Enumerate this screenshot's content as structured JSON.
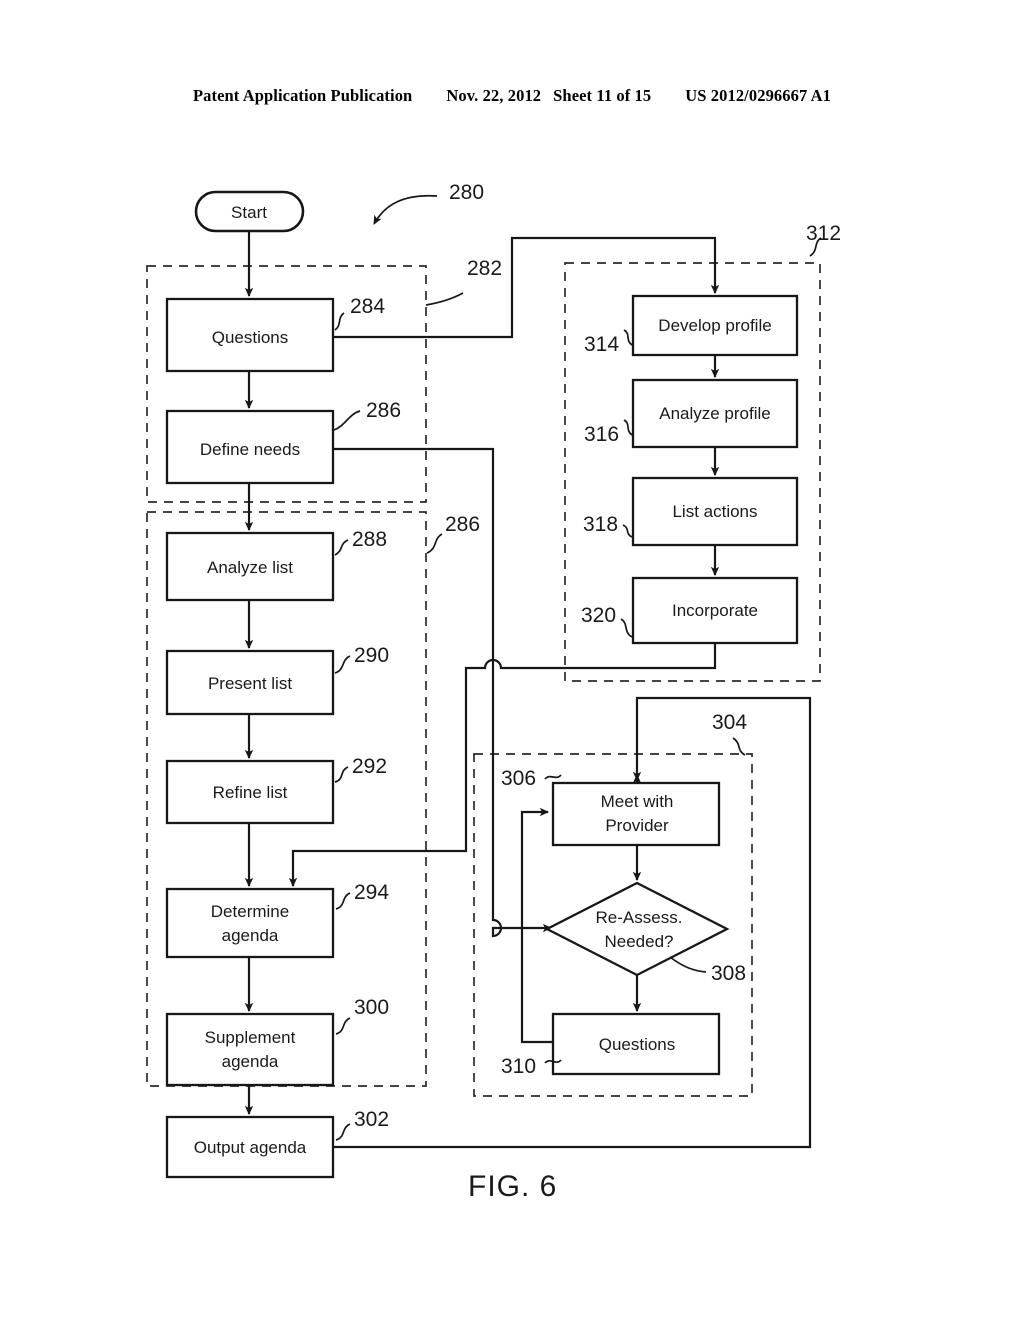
{
  "header": {
    "publication": "Patent Application Publication",
    "date": "Nov. 22, 2012",
    "sheet": "Sheet 11 of 15",
    "pub_number": "US 2012/0296667 A1"
  },
  "figure": {
    "caption": "FIG. 6",
    "overall_ref": "280"
  },
  "groups": [
    {
      "ref": "282",
      "name": "assessment-group"
    },
    {
      "ref": "286",
      "name": "list-agenda-group"
    },
    {
      "ref": "312",
      "name": "profile-group"
    },
    {
      "ref": "304",
      "name": "provider-meeting-group"
    }
  ],
  "nodes": [
    {
      "id": "start",
      "label": "Start",
      "shape": "stadium",
      "ref": ""
    },
    {
      "id": "questions1",
      "label": "Questions",
      "shape": "rect",
      "ref": "284"
    },
    {
      "id": "define",
      "label": "Define needs",
      "shape": "rect",
      "ref": "286"
    },
    {
      "id": "analyze",
      "label": "Analyze list",
      "shape": "rect",
      "ref": "288"
    },
    {
      "id": "present",
      "label": "Present list",
      "shape": "rect",
      "ref": "290"
    },
    {
      "id": "refine",
      "label": "Refine list",
      "shape": "rect",
      "ref": "292"
    },
    {
      "id": "determine",
      "label": "Determine agenda",
      "line1": "Determine",
      "line2": "agenda",
      "shape": "rect",
      "ref": "294"
    },
    {
      "id": "supplement",
      "label": "Supplement agenda",
      "line1": "Supplement",
      "line2": "agenda",
      "shape": "rect",
      "ref": "300"
    },
    {
      "id": "output",
      "label": "Output agenda",
      "shape": "rect",
      "ref": "302"
    },
    {
      "id": "develop",
      "label": "Develop profile",
      "shape": "rect",
      "ref": "314"
    },
    {
      "id": "analyzeprof",
      "label": "Analyze profile",
      "shape": "rect",
      "ref": "316"
    },
    {
      "id": "listact",
      "label": "List actions",
      "shape": "rect",
      "ref": "318"
    },
    {
      "id": "incorporate",
      "label": "Incorporate",
      "shape": "rect",
      "ref": "320"
    },
    {
      "id": "meet",
      "label": "Meet with Provider",
      "line1": "Meet with",
      "line2": "Provider",
      "shape": "rect",
      "ref": "306"
    },
    {
      "id": "reassess",
      "label": "Re-Assess. Needed?",
      "line1": "Re-Assess.",
      "line2": "Needed?",
      "shape": "diamond",
      "ref": "308"
    },
    {
      "id": "questions2",
      "label": "Questions",
      "shape": "rect",
      "ref": "310"
    }
  ],
  "labels": {
    "start": "Start",
    "questions1": "Questions",
    "define": "Define needs",
    "analyze": "Analyze list",
    "present": "Present list",
    "refine": "Refine list",
    "determine_l1": "Determine",
    "determine_l2": "agenda",
    "supplement_l1": "Supplement",
    "supplement_l2": "agenda",
    "output": "Output agenda",
    "develop": "Develop profile",
    "analyzeprof": "Analyze profile",
    "listact": "List actions",
    "incorporate": "Incorporate",
    "meet_l1": "Meet with",
    "meet_l2": "Provider",
    "reassess_l1": "Re-Assess.",
    "reassess_l2": "Needed?",
    "questions2": "Questions"
  },
  "refs": {
    "r280": "280",
    "r282": "282",
    "r284": "284",
    "r286a": "286",
    "r286b": "286",
    "r288": "288",
    "r290": "290",
    "r292": "292",
    "r294": "294",
    "r300": "300",
    "r302": "302",
    "r304": "304",
    "r306": "306",
    "r308": "308",
    "r310": "310",
    "r312": "312",
    "r314": "314",
    "r316": "316",
    "r318": "318",
    "r320": "320"
  },
  "colors": {
    "ink": "#171717",
    "background": "#ffffff",
    "dashed_group": "#2a2a2a"
  }
}
